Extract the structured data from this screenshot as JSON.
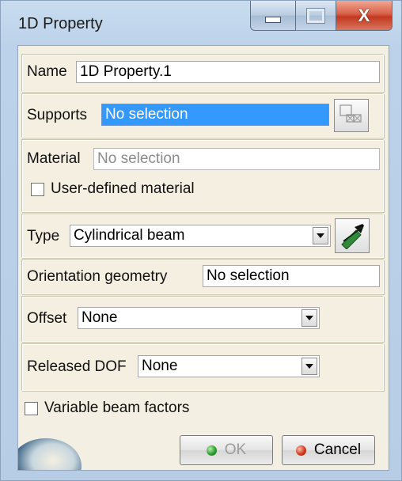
{
  "window": {
    "title": "1D Property",
    "minimize_glyph": "",
    "close_glyph": "X"
  },
  "name": {
    "label": "Name",
    "value": "1D Property.1"
  },
  "supports": {
    "label": "Supports",
    "value": "No selection"
  },
  "material": {
    "label": "Material",
    "value": "No selection",
    "user_defined_label": "User-defined material",
    "user_defined_checked": false
  },
  "type": {
    "label": "Type",
    "value": "Cylindrical beam"
  },
  "orientation": {
    "label": "Orientation geometry",
    "value": "No selection"
  },
  "offset": {
    "label": "Offset",
    "value": "None"
  },
  "released_dof": {
    "label": "Released DOF",
    "value": "None"
  },
  "variable_beam": {
    "label": "Variable beam factors",
    "checked": false
  },
  "buttons": {
    "ok_label": "OK",
    "cancel_label": "Cancel"
  },
  "colors": {
    "selection_highlight": "#3399ff",
    "panel_background": "#f3efe2",
    "ok_indicator": "#2e9e2e",
    "cancel_indicator": "#d43a1e"
  },
  "icons": {
    "supports_button": "multi-select-icon",
    "type_button": "beam-section-icon",
    "ok": "green-dot-icon",
    "cancel": "red-dot-icon"
  }
}
